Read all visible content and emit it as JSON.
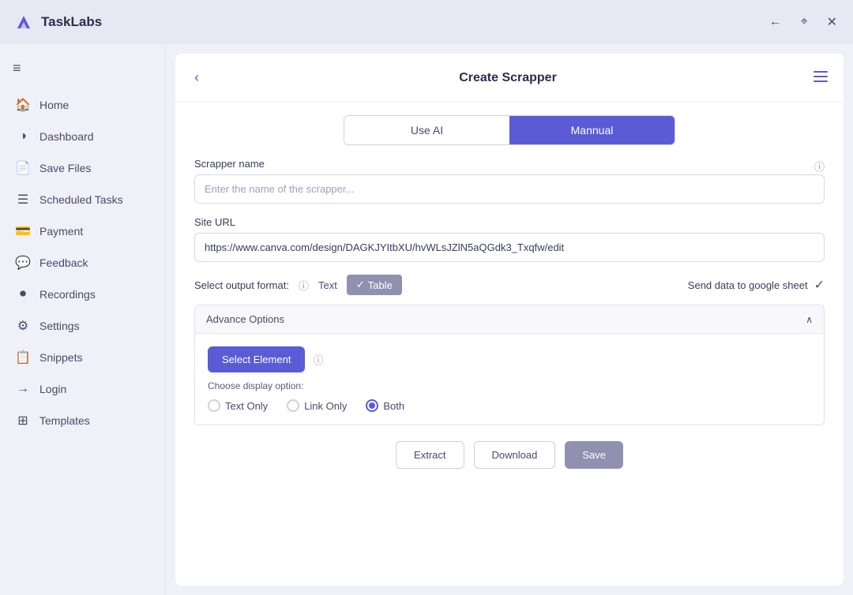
{
  "titleBar": {
    "appName": "TaskLabs",
    "controls": {
      "back": "←",
      "pin": "⌖",
      "close": "✕"
    }
  },
  "sidebar": {
    "menuToggle": "≡",
    "items": [
      {
        "id": "home",
        "label": "Home",
        "icon": "🏠"
      },
      {
        "id": "dashboard",
        "label": "Dashboard",
        "icon": "◑"
      },
      {
        "id": "save-files",
        "label": "Save Files",
        "icon": "📄"
      },
      {
        "id": "scheduled-tasks",
        "label": "Scheduled Tasks",
        "icon": "☰"
      },
      {
        "id": "payment",
        "label": "Payment",
        "icon": "💳"
      },
      {
        "id": "feedback",
        "label": "Feedback",
        "icon": "💬"
      },
      {
        "id": "recordings",
        "label": "Recordings",
        "icon": "⏺"
      },
      {
        "id": "settings",
        "label": "Settings",
        "icon": "⚙"
      },
      {
        "id": "snippets",
        "label": "Snippets",
        "icon": "📋"
      },
      {
        "id": "login",
        "label": "Login",
        "icon": "→"
      },
      {
        "id": "templates",
        "label": "Templates",
        "icon": "⊞"
      }
    ]
  },
  "content": {
    "title": "Create Scrapper",
    "backIcon": "‹",
    "listIcon": "≡",
    "tabs": [
      {
        "id": "use-ai",
        "label": "Use AI",
        "active": false
      },
      {
        "id": "manual",
        "label": "Mannual",
        "active": true
      }
    ],
    "form": {
      "scrapper_name_label": "Scrapper name",
      "scrapper_name_placeholder": "Enter the name of the scrapper...",
      "site_url_label": "Site URL",
      "site_url_value": "https://www.canva.com/design/DAGKJYItbXU/hvWLsJZlN5aQGdk3_Txqfw/edit",
      "output_format_label": "Select output format:",
      "output_format_text": "Text",
      "output_format_table": "Table",
      "google_sheet_label": "Send data to google sheet",
      "advance_options_label": "Advance Options",
      "select_element_btn": "Select Element",
      "display_option_label": "Choose display option:",
      "radio_options": [
        {
          "id": "text-only",
          "label": "Text Only",
          "selected": false
        },
        {
          "id": "link-only",
          "label": "Link Only",
          "selected": false
        },
        {
          "id": "both",
          "label": "Both",
          "selected": true
        }
      ],
      "btn_extract": "Extract",
      "btn_download": "Download",
      "btn_save": "Save"
    }
  }
}
